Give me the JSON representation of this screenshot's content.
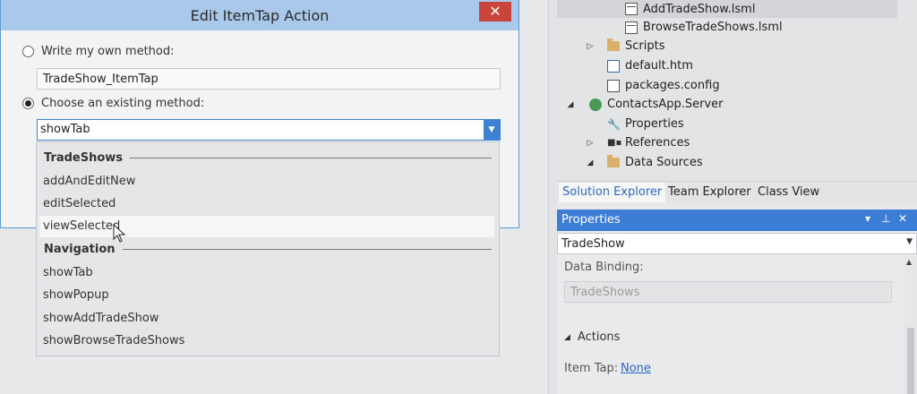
{
  "dialog": {
    "title": "Edit ItemTap Action",
    "close_glyph": "✕",
    "radio_own_label": "Write my own method:",
    "own_method_value": "TradeShow_ItemTap",
    "radio_existing_label": "Choose an existing method:",
    "selected_method": "showTab",
    "dropdown": {
      "group1": "TradeShows",
      "group1_items": [
        "addAndEditNew",
        "editSelected",
        "viewSelected"
      ],
      "group2": "Navigation",
      "group2_items": [
        "showTab",
        "showPopup",
        "showAddTradeShow",
        "showBrowseTradeShows"
      ]
    }
  },
  "solution_explorer": {
    "items": {
      "add_trade_show": "AddTradeShow.lsml",
      "browse_trade_shows": "BrowseTradeShows.lsml",
      "scripts": "Scripts",
      "default_htm": "default.htm",
      "packages_config": "packages.config",
      "server_project": "ContactsApp.Server",
      "properties": "Properties",
      "references": "References",
      "data_sources": "Data Sources"
    },
    "tabs": [
      "Solution Explorer",
      "Team Explorer",
      "Class View"
    ]
  },
  "properties_panel": {
    "title": "Properties",
    "object": "TradeShow",
    "data_binding_label": "Data Binding:",
    "data_binding_value": "TradeShows",
    "actions_section": "Actions",
    "item_tap_label": "Item Tap:",
    "item_tap_value": "None"
  },
  "colors": {
    "accent": "#3c7ed6",
    "title_bar": "#a9c8ea",
    "close_button": "#c9443a",
    "link": "#2a69c2"
  }
}
